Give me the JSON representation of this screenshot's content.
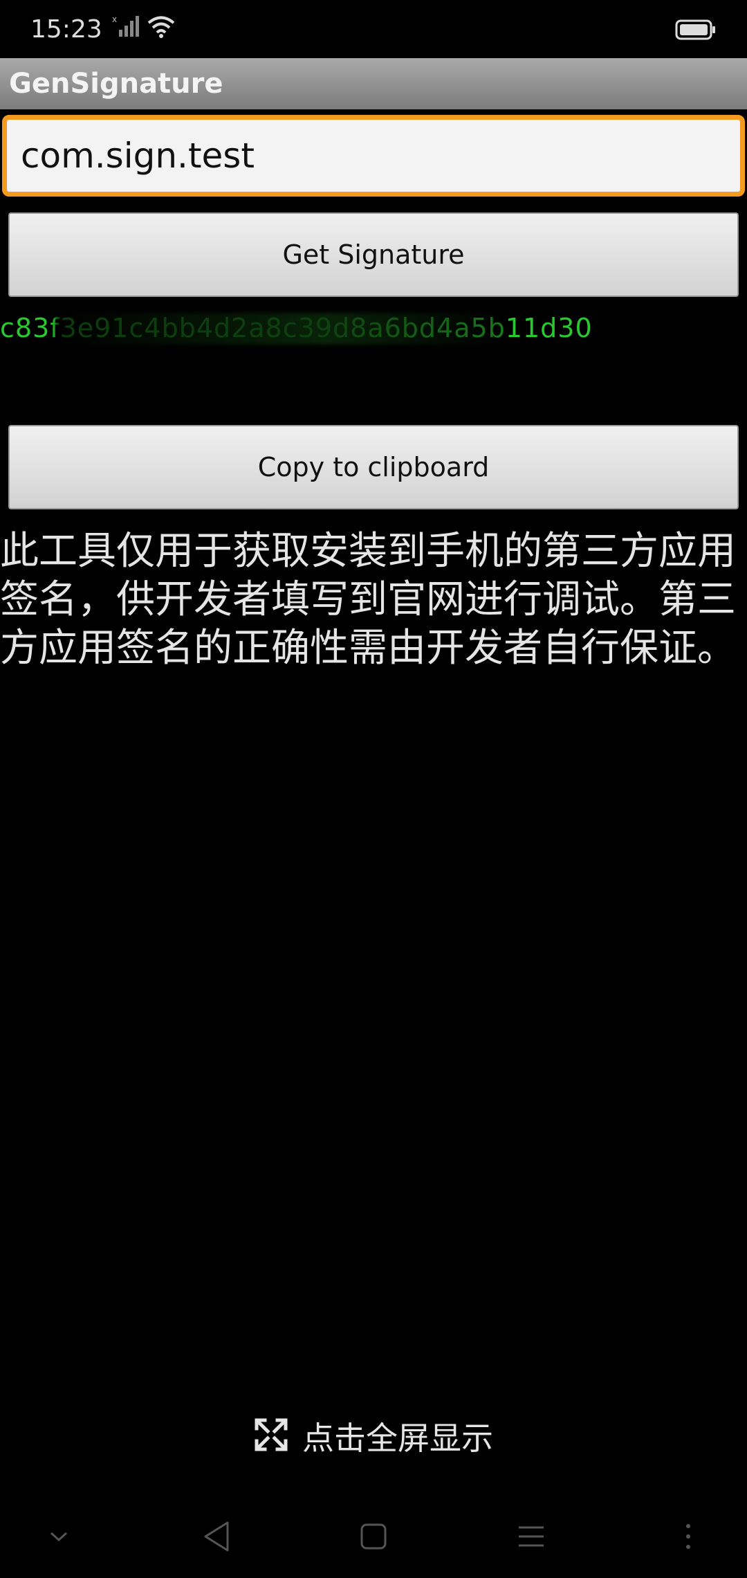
{
  "status_bar": {
    "time": "15:23"
  },
  "app": {
    "title": "GenSignature"
  },
  "form": {
    "package_value": "com.sign.test",
    "get_signature_label": "Get Signature",
    "signature_value": "c83f3e91c4bb4d2a8c39d8a6bd4a5b11d30",
    "copy_label": "Copy to clipboard"
  },
  "notice": {
    "text": "此工具仅用于获取安装到手机的第三方应用签名，供开发者填写到官网进行调试。第三方应用签名的正确性需由开发者自行保证。"
  },
  "fullscreen": {
    "label": "点击全屏显示"
  },
  "colors": {
    "title_bar": "#8c8c8c",
    "input_border": "#f39a1f",
    "signature_text": "#29c92f"
  },
  "icons": {
    "signal": "signal-icon",
    "wifi": "wifi-icon",
    "battery": "battery-icon",
    "fullscreen": "expand-icon",
    "nav": [
      "chevron-down-icon",
      "back-icon",
      "home-icon",
      "menu-icon",
      "more-icon"
    ]
  }
}
